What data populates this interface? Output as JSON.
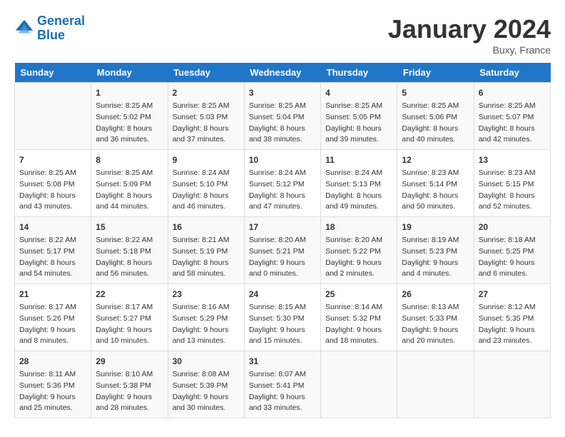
{
  "header": {
    "logo_line1": "General",
    "logo_line2": "Blue",
    "month_title": "January 2024",
    "location": "Buxy, France"
  },
  "days_of_week": [
    "Sunday",
    "Monday",
    "Tuesday",
    "Wednesday",
    "Thursday",
    "Friday",
    "Saturday"
  ],
  "weeks": [
    [
      {
        "num": "",
        "sunrise": "",
        "sunset": "",
        "daylight": ""
      },
      {
        "num": "1",
        "sunrise": "Sunrise: 8:25 AM",
        "sunset": "Sunset: 5:02 PM",
        "daylight": "Daylight: 8 hours and 36 minutes."
      },
      {
        "num": "2",
        "sunrise": "Sunrise: 8:25 AM",
        "sunset": "Sunset: 5:03 PM",
        "daylight": "Daylight: 8 hours and 37 minutes."
      },
      {
        "num": "3",
        "sunrise": "Sunrise: 8:25 AM",
        "sunset": "Sunset: 5:04 PM",
        "daylight": "Daylight: 8 hours and 38 minutes."
      },
      {
        "num": "4",
        "sunrise": "Sunrise: 8:25 AM",
        "sunset": "Sunset: 5:05 PM",
        "daylight": "Daylight: 8 hours and 39 minutes."
      },
      {
        "num": "5",
        "sunrise": "Sunrise: 8:25 AM",
        "sunset": "Sunset: 5:06 PM",
        "daylight": "Daylight: 8 hours and 40 minutes."
      },
      {
        "num": "6",
        "sunrise": "Sunrise: 8:25 AM",
        "sunset": "Sunset: 5:07 PM",
        "daylight": "Daylight: 8 hours and 42 minutes."
      }
    ],
    [
      {
        "num": "7",
        "sunrise": "Sunrise: 8:25 AM",
        "sunset": "Sunset: 5:08 PM",
        "daylight": "Daylight: 8 hours and 43 minutes."
      },
      {
        "num": "8",
        "sunrise": "Sunrise: 8:25 AM",
        "sunset": "Sunset: 5:09 PM",
        "daylight": "Daylight: 8 hours and 44 minutes."
      },
      {
        "num": "9",
        "sunrise": "Sunrise: 8:24 AM",
        "sunset": "Sunset: 5:10 PM",
        "daylight": "Daylight: 8 hours and 46 minutes."
      },
      {
        "num": "10",
        "sunrise": "Sunrise: 8:24 AM",
        "sunset": "Sunset: 5:12 PM",
        "daylight": "Daylight: 8 hours and 47 minutes."
      },
      {
        "num": "11",
        "sunrise": "Sunrise: 8:24 AM",
        "sunset": "Sunset: 5:13 PM",
        "daylight": "Daylight: 8 hours and 49 minutes."
      },
      {
        "num": "12",
        "sunrise": "Sunrise: 8:23 AM",
        "sunset": "Sunset: 5:14 PM",
        "daylight": "Daylight: 8 hours and 50 minutes."
      },
      {
        "num": "13",
        "sunrise": "Sunrise: 8:23 AM",
        "sunset": "Sunset: 5:15 PM",
        "daylight": "Daylight: 8 hours and 52 minutes."
      }
    ],
    [
      {
        "num": "14",
        "sunrise": "Sunrise: 8:22 AM",
        "sunset": "Sunset: 5:17 PM",
        "daylight": "Daylight: 8 hours and 54 minutes."
      },
      {
        "num": "15",
        "sunrise": "Sunrise: 8:22 AM",
        "sunset": "Sunset: 5:18 PM",
        "daylight": "Daylight: 8 hours and 56 minutes."
      },
      {
        "num": "16",
        "sunrise": "Sunrise: 8:21 AM",
        "sunset": "Sunset: 5:19 PM",
        "daylight": "Daylight: 8 hours and 58 minutes."
      },
      {
        "num": "17",
        "sunrise": "Sunrise: 8:20 AM",
        "sunset": "Sunset: 5:21 PM",
        "daylight": "Daylight: 9 hours and 0 minutes."
      },
      {
        "num": "18",
        "sunrise": "Sunrise: 8:20 AM",
        "sunset": "Sunset: 5:22 PM",
        "daylight": "Daylight: 9 hours and 2 minutes."
      },
      {
        "num": "19",
        "sunrise": "Sunrise: 8:19 AM",
        "sunset": "Sunset: 5:23 PM",
        "daylight": "Daylight: 9 hours and 4 minutes."
      },
      {
        "num": "20",
        "sunrise": "Sunrise: 8:18 AM",
        "sunset": "Sunset: 5:25 PM",
        "daylight": "Daylight: 9 hours and 6 minutes."
      }
    ],
    [
      {
        "num": "21",
        "sunrise": "Sunrise: 8:17 AM",
        "sunset": "Sunset: 5:26 PM",
        "daylight": "Daylight: 9 hours and 8 minutes."
      },
      {
        "num": "22",
        "sunrise": "Sunrise: 8:17 AM",
        "sunset": "Sunset: 5:27 PM",
        "daylight": "Daylight: 9 hours and 10 minutes."
      },
      {
        "num": "23",
        "sunrise": "Sunrise: 8:16 AM",
        "sunset": "Sunset: 5:29 PM",
        "daylight": "Daylight: 9 hours and 13 minutes."
      },
      {
        "num": "24",
        "sunrise": "Sunrise: 8:15 AM",
        "sunset": "Sunset: 5:30 PM",
        "daylight": "Daylight: 9 hours and 15 minutes."
      },
      {
        "num": "25",
        "sunrise": "Sunrise: 8:14 AM",
        "sunset": "Sunset: 5:32 PM",
        "daylight": "Daylight: 9 hours and 18 minutes."
      },
      {
        "num": "26",
        "sunrise": "Sunrise: 8:13 AM",
        "sunset": "Sunset: 5:33 PM",
        "daylight": "Daylight: 9 hours and 20 minutes."
      },
      {
        "num": "27",
        "sunrise": "Sunrise: 8:12 AM",
        "sunset": "Sunset: 5:35 PM",
        "daylight": "Daylight: 9 hours and 23 minutes."
      }
    ],
    [
      {
        "num": "28",
        "sunrise": "Sunrise: 8:11 AM",
        "sunset": "Sunset: 5:36 PM",
        "daylight": "Daylight: 9 hours and 25 minutes."
      },
      {
        "num": "29",
        "sunrise": "Sunrise: 8:10 AM",
        "sunset": "Sunset: 5:38 PM",
        "daylight": "Daylight: 9 hours and 28 minutes."
      },
      {
        "num": "30",
        "sunrise": "Sunrise: 8:08 AM",
        "sunset": "Sunset: 5:39 PM",
        "daylight": "Daylight: 9 hours and 30 minutes."
      },
      {
        "num": "31",
        "sunrise": "Sunrise: 8:07 AM",
        "sunset": "Sunset: 5:41 PM",
        "daylight": "Daylight: 9 hours and 33 minutes."
      },
      {
        "num": "",
        "sunrise": "",
        "sunset": "",
        "daylight": ""
      },
      {
        "num": "",
        "sunrise": "",
        "sunset": "",
        "daylight": ""
      },
      {
        "num": "",
        "sunrise": "",
        "sunset": "",
        "daylight": ""
      }
    ]
  ]
}
